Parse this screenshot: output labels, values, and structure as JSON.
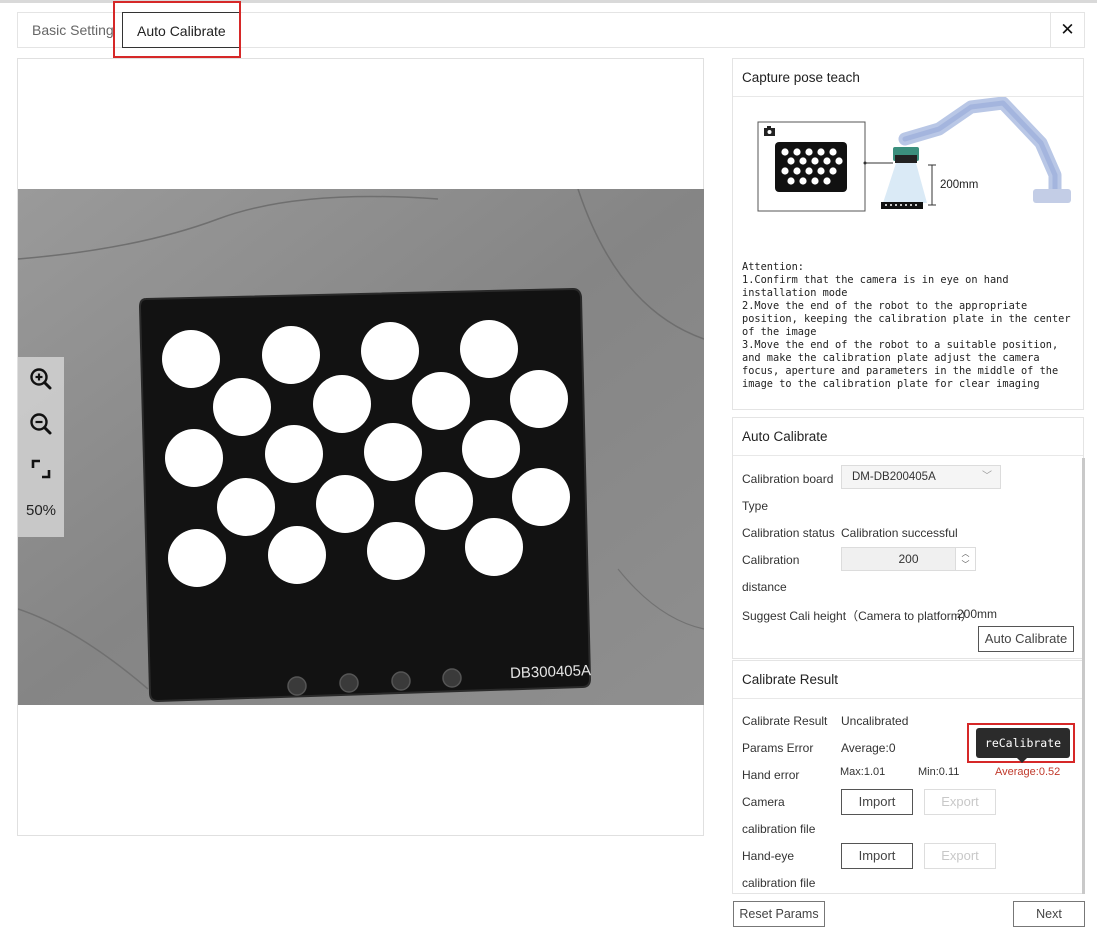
{
  "tabs": {
    "basic": "Basic Setting",
    "auto": "Auto Calibrate"
  },
  "viewer": {
    "zoom_level": "50%",
    "board_label": "DB300405A"
  },
  "capture_pose": {
    "title": "Capture pose teach",
    "distance_label": "200mm",
    "attention": "Attention:\n1.Confirm that the camera is in eye on hand installation mode\n2.Move the end of the robot to the appropriate position, keeping the calibration plate in the center of the image\n3.Move the end of the robot to a suitable position, and make the calibration plate adjust the camera focus, aperture and parameters in the middle of the image to the calibration plate for clear imaging"
  },
  "auto_calibrate": {
    "title": "Auto Calibrate",
    "board_label_line1": "Calibration board",
    "board_label_line2": "Type",
    "board_value": "DM-DB200405A",
    "status_label": "Calibration status",
    "status_value": "Calibration successful",
    "distance_label_line1": "Calibration",
    "distance_label_line2": "distance",
    "distance_value": "200",
    "suggest_label": "Suggest Cali height（Camera to platform）",
    "suggest_value": "200mm",
    "button": "Auto Calibrate"
  },
  "calibrate_result": {
    "title": "Calibrate Result",
    "result_label": "Calibrate Result",
    "result_value": "Uncalibrated",
    "params_error_label": "Params Error",
    "params_error_value": "Average:0",
    "recalibrate_button": "reCalibrate",
    "hand_error_label": "Hand error",
    "hand_error_max": "Max:1.01",
    "hand_error_min": "Min:0.11",
    "hand_error_avg": "Average:0.52",
    "camera_file_line1": "Camera",
    "camera_file_line2": "calibration file",
    "handeye_file_line1": "Hand-eye",
    "handeye_file_line2": "calibration file",
    "import": "Import",
    "export": "Export"
  },
  "footer": {
    "reset": "Reset Params",
    "next": "Next"
  },
  "colors": {
    "highlight": "#d62828",
    "error_avg": "#c0392b",
    "recalibrate_bg": "#2b2b2b"
  }
}
